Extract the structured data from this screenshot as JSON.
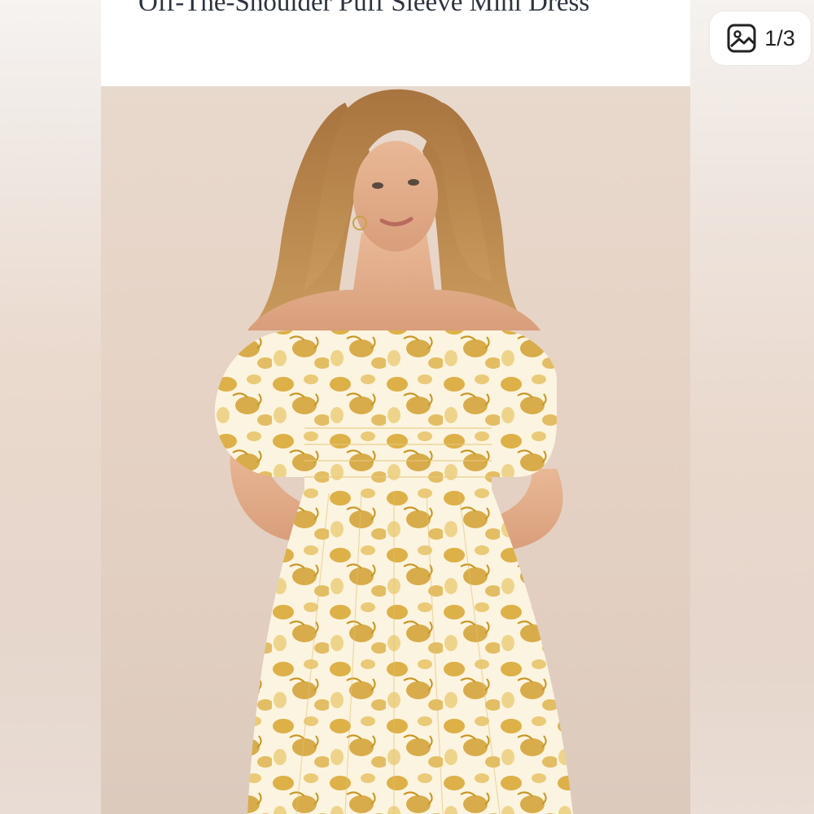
{
  "product": {
    "title": "Off-The-Shoulder Puff Sleeve Mini Dress"
  },
  "gallery": {
    "counter_text": "1/3",
    "counter_icon": "image-gallery-icon",
    "photo_alt": "Model wearing yellow floral off-the-shoulder puff sleeve mini dress"
  },
  "colors": {
    "dress_yellow": "#d9a62e",
    "dress_cream": "#fbf4e0",
    "background_beige": "#e6d3c5",
    "title_text": "#2d3440"
  }
}
